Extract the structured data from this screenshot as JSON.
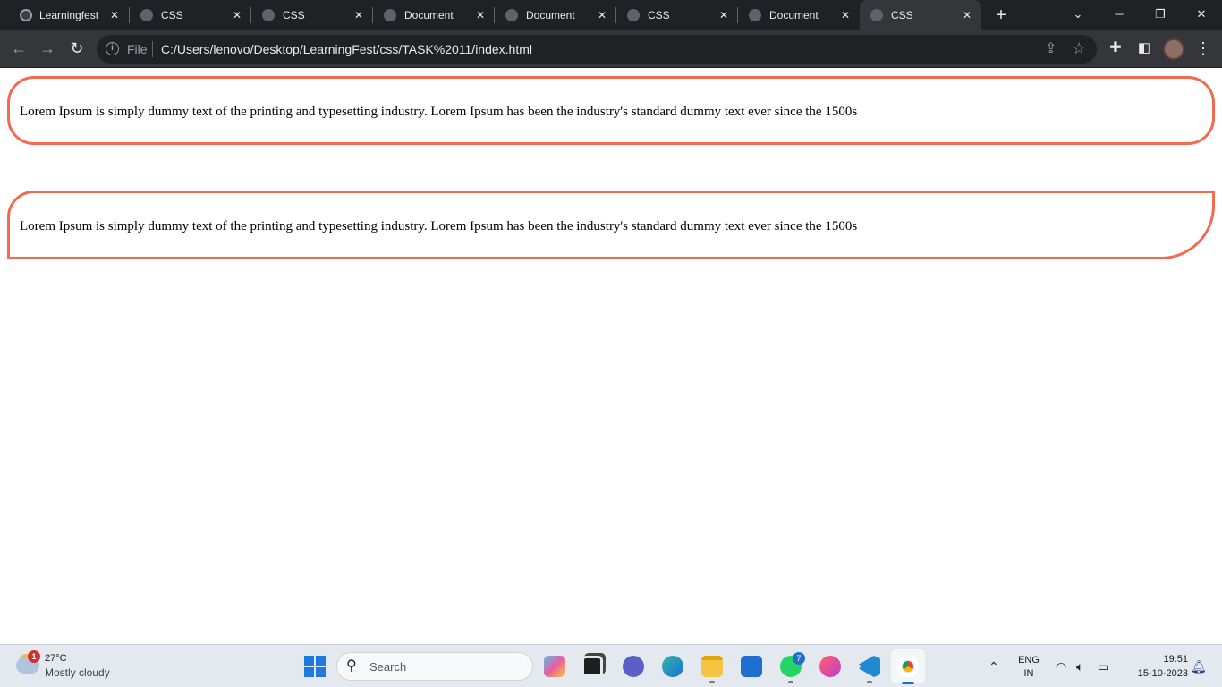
{
  "browser": {
    "tabs": [
      {
        "title": "Learningfest",
        "favicon": "github-icon",
        "active": false
      },
      {
        "title": "CSS",
        "favicon": "globe-icon",
        "active": false
      },
      {
        "title": "CSS",
        "favicon": "globe-icon",
        "active": false
      },
      {
        "title": "Document",
        "favicon": "globe-icon",
        "active": false
      },
      {
        "title": "Document",
        "favicon": "globe-icon",
        "active": false
      },
      {
        "title": "CSS",
        "favicon": "globe-icon",
        "active": false
      },
      {
        "title": "Document",
        "favicon": "globe-icon",
        "active": false
      },
      {
        "title": "CSS",
        "favicon": "globe-icon",
        "active": true
      }
    ],
    "new_tab_label": "+",
    "omnibox": {
      "scheme_label": "File",
      "url": "C:/Users/lenovo/Desktop/LearningFest/css/TASK%2011/index.html"
    }
  },
  "page": {
    "box1_text": "Lorem Ipsum is simply dummy text of the printing and typesetting industry. Lorem Ipsum has been the industry's standard dummy text ever since the 1500s",
    "box2_text": "Lorem Ipsum is simply dummy text of the printing and typesetting industry. Lorem Ipsum has been the industry's standard dummy text ever since the 1500s",
    "border_color": "#f26b4f"
  },
  "taskbar": {
    "weather": {
      "badge": "1",
      "temp": "27°C",
      "condition": "Mostly cloudy"
    },
    "search_placeholder": "Search",
    "whatsapp_badge": "7",
    "tray": {
      "lang_top": "ENG",
      "lang_bottom": "IN",
      "time": "19:51",
      "date": "15-10-2023"
    }
  }
}
